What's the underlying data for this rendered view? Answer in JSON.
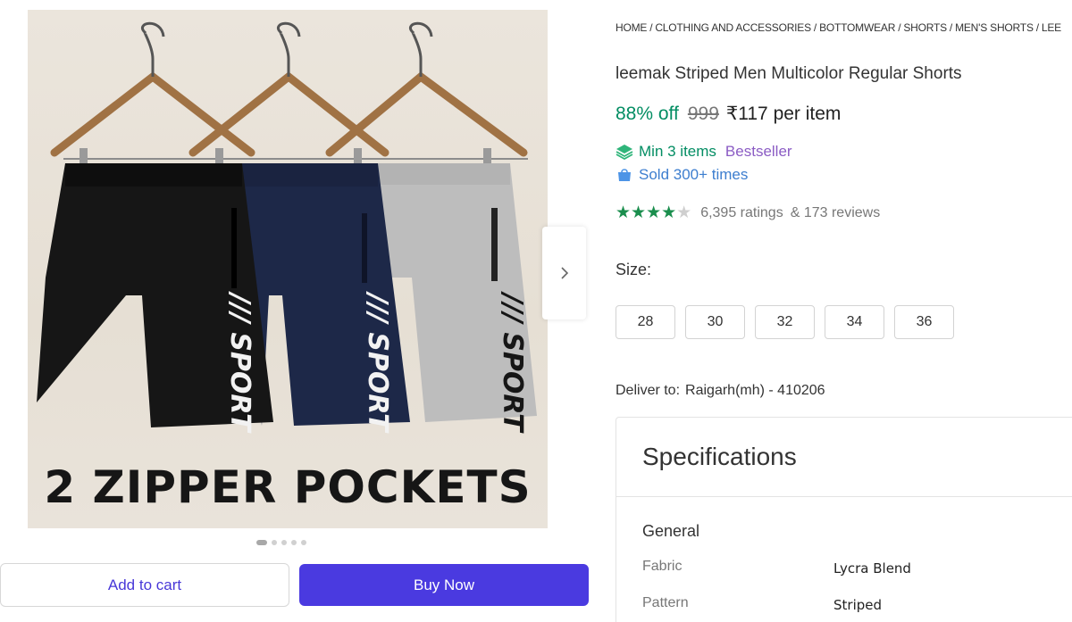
{
  "gallery": {
    "caption": "2 ZIPPER POCKETS",
    "shorts_logo_text": "SPORT",
    "dots_total": 5,
    "dots_active_index": 0,
    "next_icon": "chevron-right-icon",
    "shorts_colors": [
      "#161616",
      "#1d2848",
      "#bdbdbd"
    ]
  },
  "actions": {
    "add_to_cart": "Add to cart",
    "buy_now": "Buy Now"
  },
  "breadcrumb": [
    "HOME",
    "CLOTHING AND ACCESSORIES",
    "BOTTOMWEAR",
    "SHORTS",
    "MEN'S SHORTS",
    "LEE"
  ],
  "product": {
    "title": "leemak Striped Men Multicolor Regular Shorts",
    "discount": "88% off",
    "mrp": "999",
    "price": "₹117 per item",
    "min_items": "Min 3 items",
    "bestseller": "Bestseller",
    "sold": "Sold 300+ times",
    "rating_stars": 4,
    "ratings": "6,395 ratings",
    "reviews": "& 173 reviews"
  },
  "size": {
    "label": "Size:",
    "options": [
      "28",
      "30",
      "32",
      "34",
      "36"
    ]
  },
  "delivery": {
    "label": "Deliver to:",
    "location": "Raigarh(mh) - 410206"
  },
  "specs": {
    "title": "Specifications",
    "group": "General",
    "rows": [
      {
        "key": "Fabric",
        "value": "Lycra Blend"
      },
      {
        "key": "Pattern",
        "value": "Striped"
      }
    ]
  },
  "colors": {
    "accent": "#4a3ae0",
    "discount": "#038d63",
    "bestseller": "#8b5cc4",
    "sold": "#3d7ecf",
    "star": "#1a8e4d"
  }
}
